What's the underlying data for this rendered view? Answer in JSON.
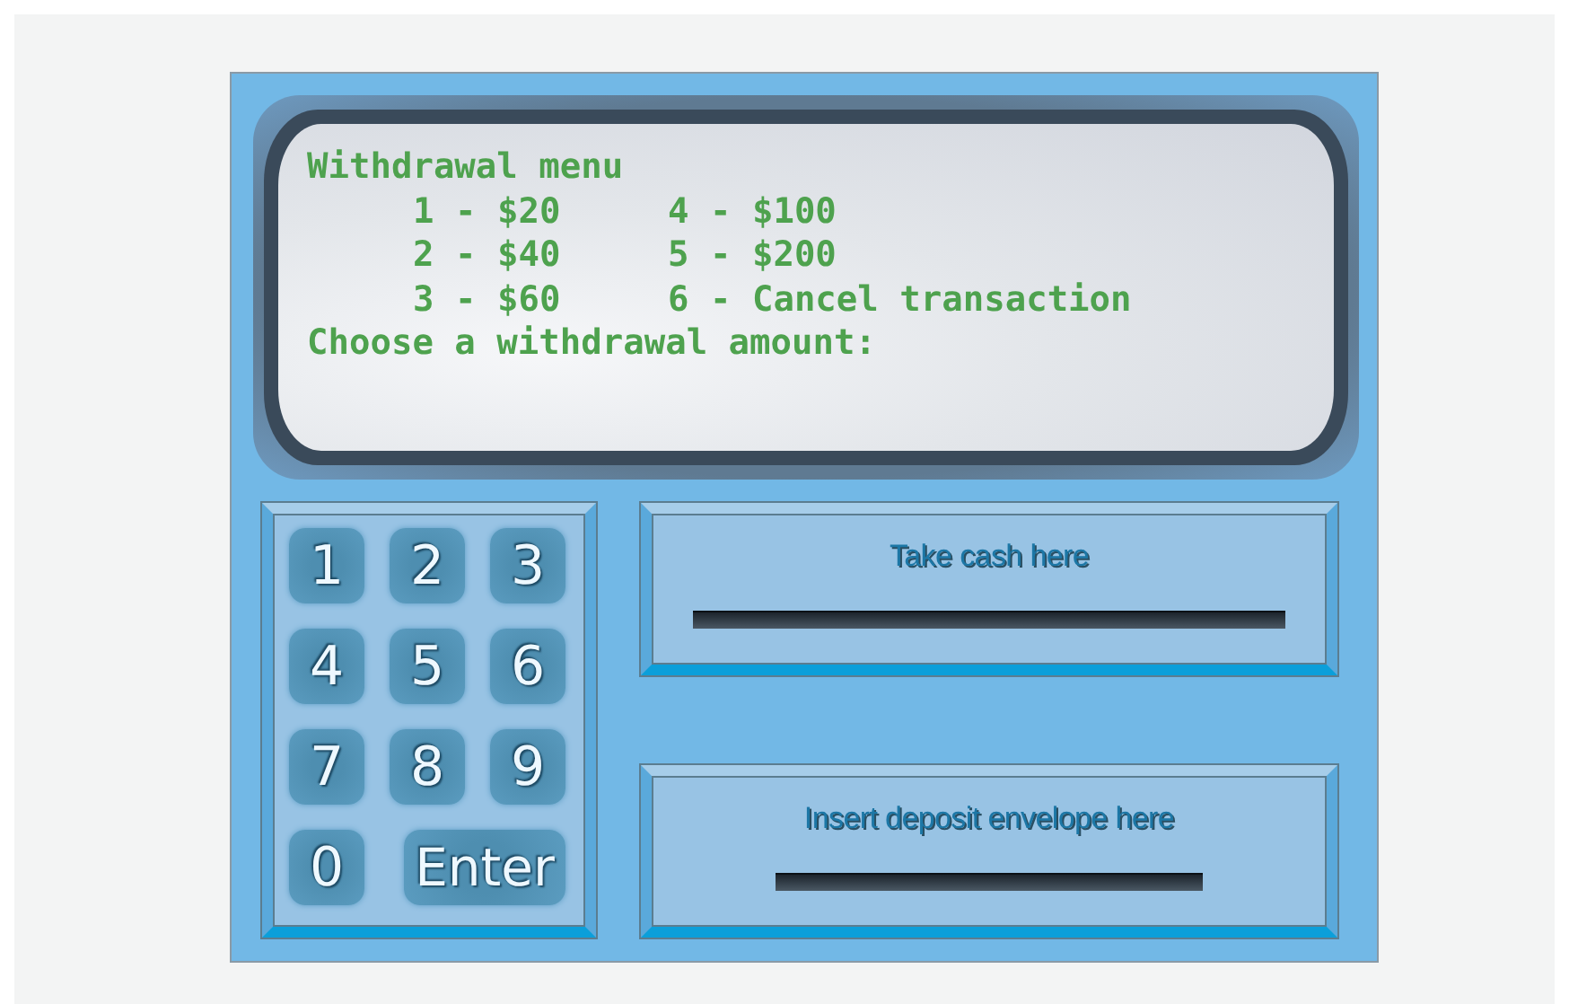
{
  "screen": {
    "heading": "Withdrawal menu",
    "options": [
      {
        "label": "1 - $20"
      },
      {
        "label": "2 - $40"
      },
      {
        "label": "3 - $60"
      },
      {
        "label": "4 - $100"
      },
      {
        "label": "5 - $200"
      },
      {
        "label": "6 - Cancel transaction"
      }
    ],
    "prompt": "Choose a withdrawal amount:"
  },
  "keypad": {
    "keys": [
      {
        "label": "1",
        "kind": "digit"
      },
      {
        "label": "2",
        "kind": "digit"
      },
      {
        "label": "3",
        "kind": "digit"
      },
      {
        "label": "4",
        "kind": "digit"
      },
      {
        "label": "5",
        "kind": "digit"
      },
      {
        "label": "6",
        "kind": "digit"
      },
      {
        "label": "7",
        "kind": "digit"
      },
      {
        "label": "8",
        "kind": "digit"
      },
      {
        "label": "9",
        "kind": "digit"
      },
      {
        "label": "0",
        "kind": "digit"
      },
      {
        "label": "Enter",
        "kind": "wide"
      }
    ]
  },
  "slots": [
    {
      "label": "Take cash here",
      "kind": "cash"
    },
    {
      "label": "Insert deposit envelope here",
      "kind": "deposit"
    }
  ]
}
